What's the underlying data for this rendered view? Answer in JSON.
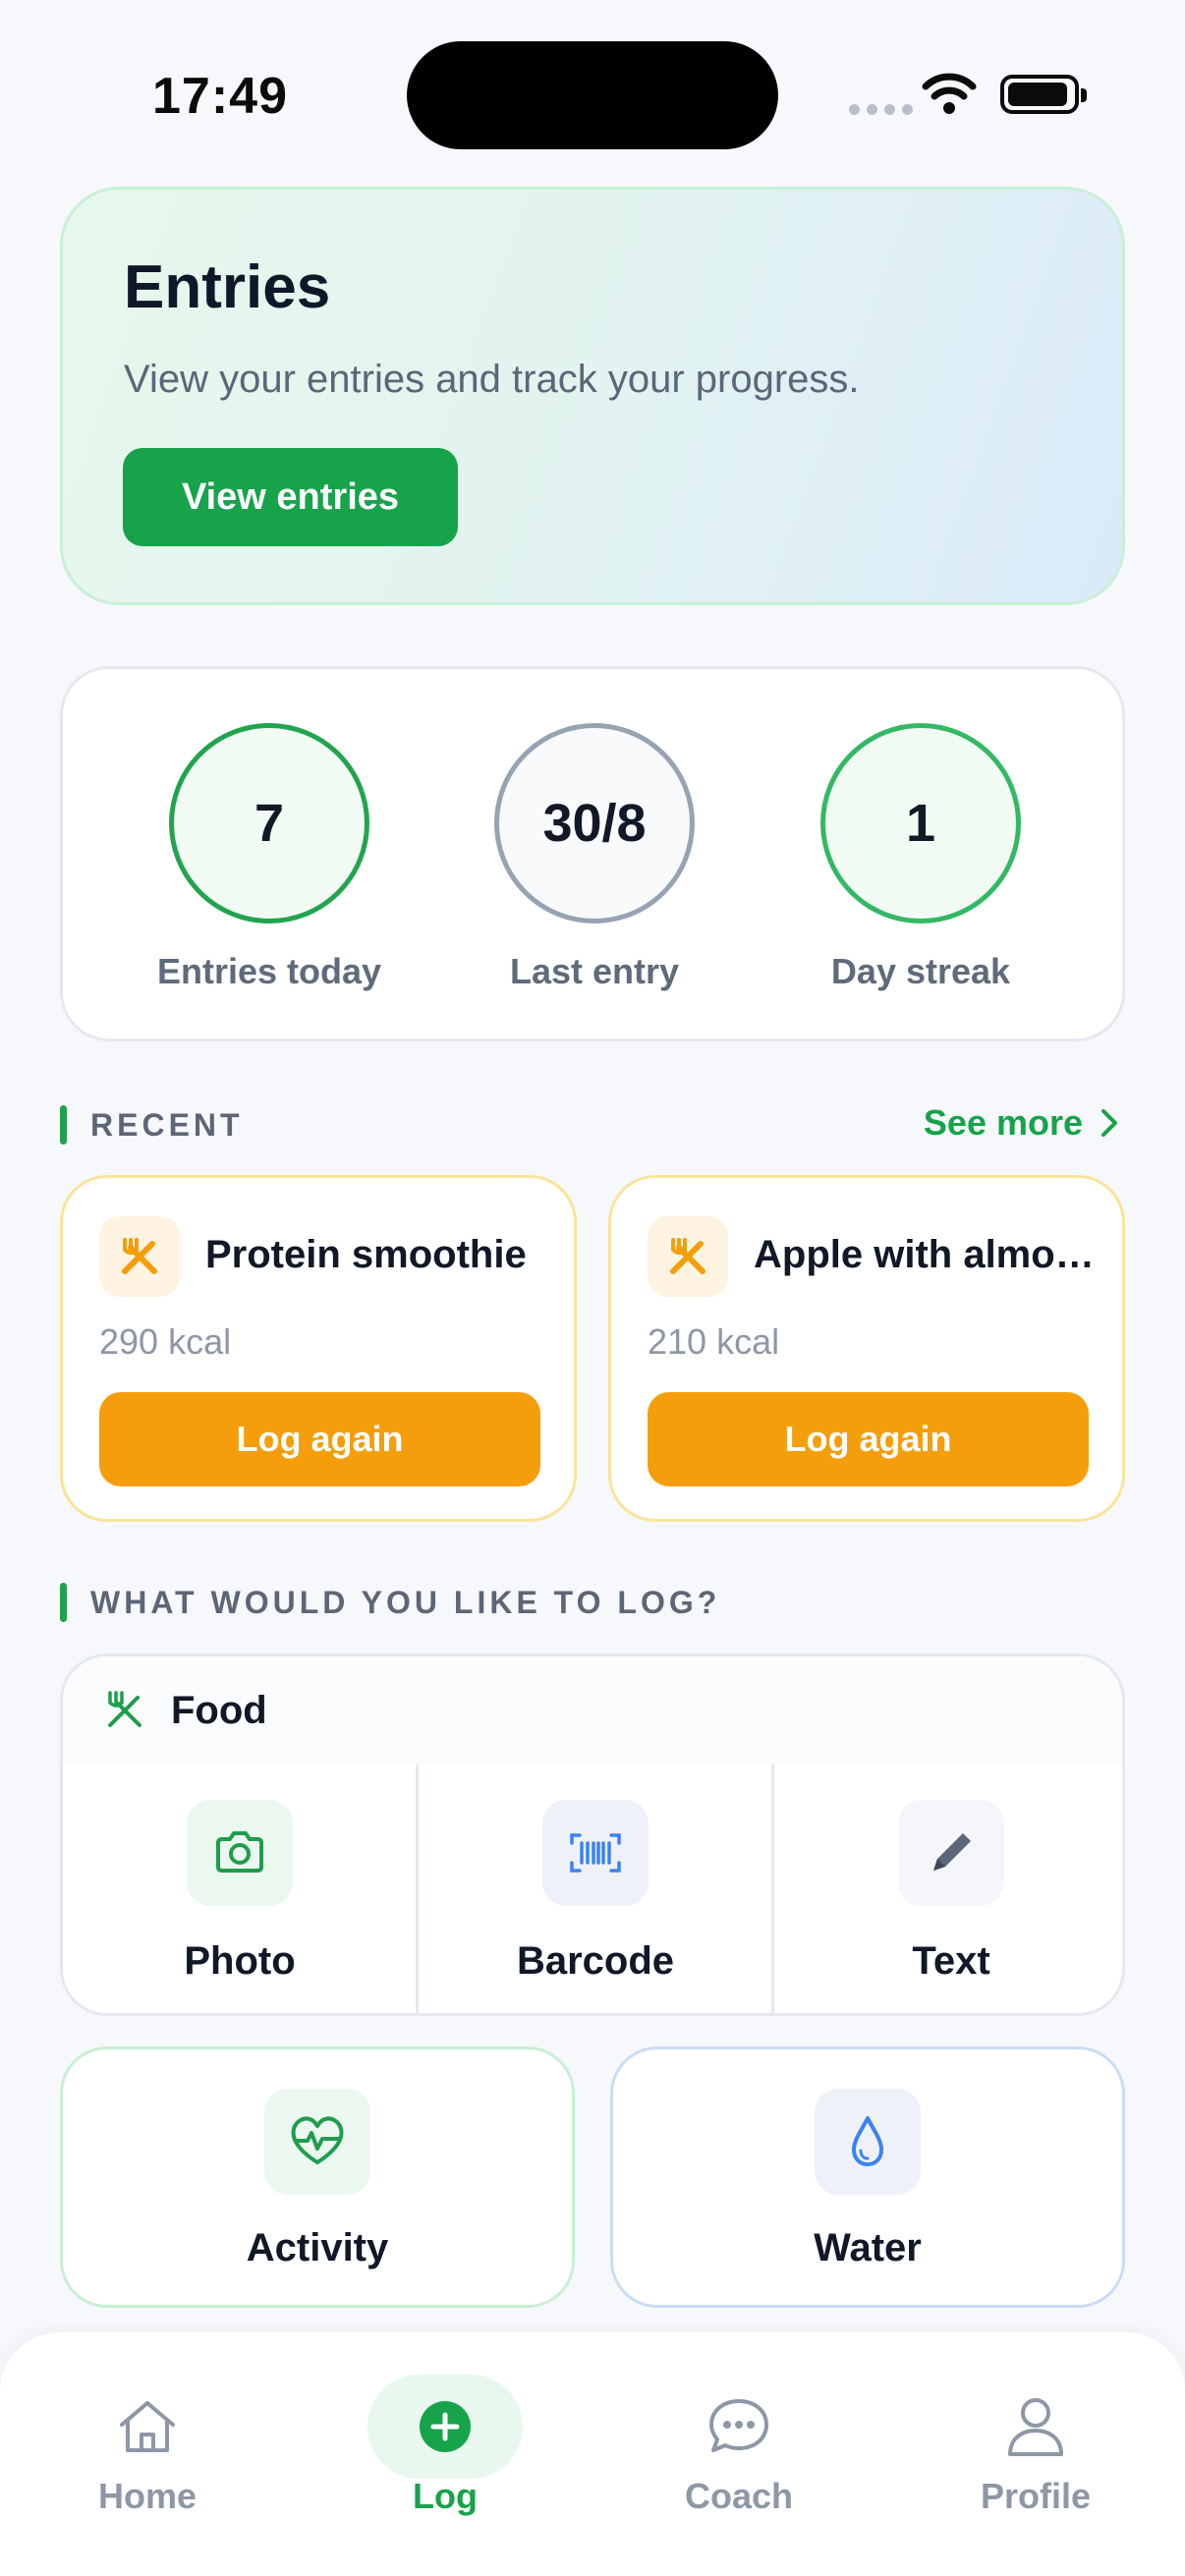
{
  "status_bar": {
    "time": "17:49"
  },
  "hero": {
    "title": "Entries",
    "subtitle": "View your entries and track your progress.",
    "button_label": "View entries"
  },
  "stats": [
    {
      "value": "7",
      "label": "Entries today"
    },
    {
      "value": "30/8",
      "label": "Last entry"
    },
    {
      "value": "1",
      "label": "Day streak"
    }
  ],
  "recent": {
    "heading": "RECENT",
    "see_more": "See more",
    "items": [
      {
        "name": "Protein smoothie",
        "kcal": "290 kcal",
        "action": "Log again",
        "icon": "fork-knife-icon"
      },
      {
        "name": "Apple with almond butter",
        "kcal": "210 kcal",
        "action": "Log again",
        "icon": "fork-knife-icon"
      }
    ]
  },
  "log": {
    "heading": "WHAT WOULD YOU LIKE TO LOG?",
    "food": {
      "title": "Food",
      "options": [
        {
          "label": "Photo",
          "icon": "camera-icon"
        },
        {
          "label": "Barcode",
          "icon": "barcode-icon"
        },
        {
          "label": "Text",
          "icon": "pencil-icon"
        }
      ]
    },
    "activity": {
      "label": "Activity",
      "icon": "heart-pulse-icon"
    },
    "water": {
      "label": "Water",
      "icon": "water-drop-icon"
    }
  },
  "tabbar": {
    "tabs": [
      {
        "label": "Home",
        "icon": "home-icon"
      },
      {
        "label": "Log",
        "icon": "plus-circle-icon",
        "active": true
      },
      {
        "label": "Coach",
        "icon": "chat-icon"
      },
      {
        "label": "Profile",
        "icon": "person-icon"
      }
    ]
  },
  "colors": {
    "brand_green": "#17a34a",
    "accent_orange": "#f59e0b",
    "muted_text": "#5f6b7c"
  }
}
